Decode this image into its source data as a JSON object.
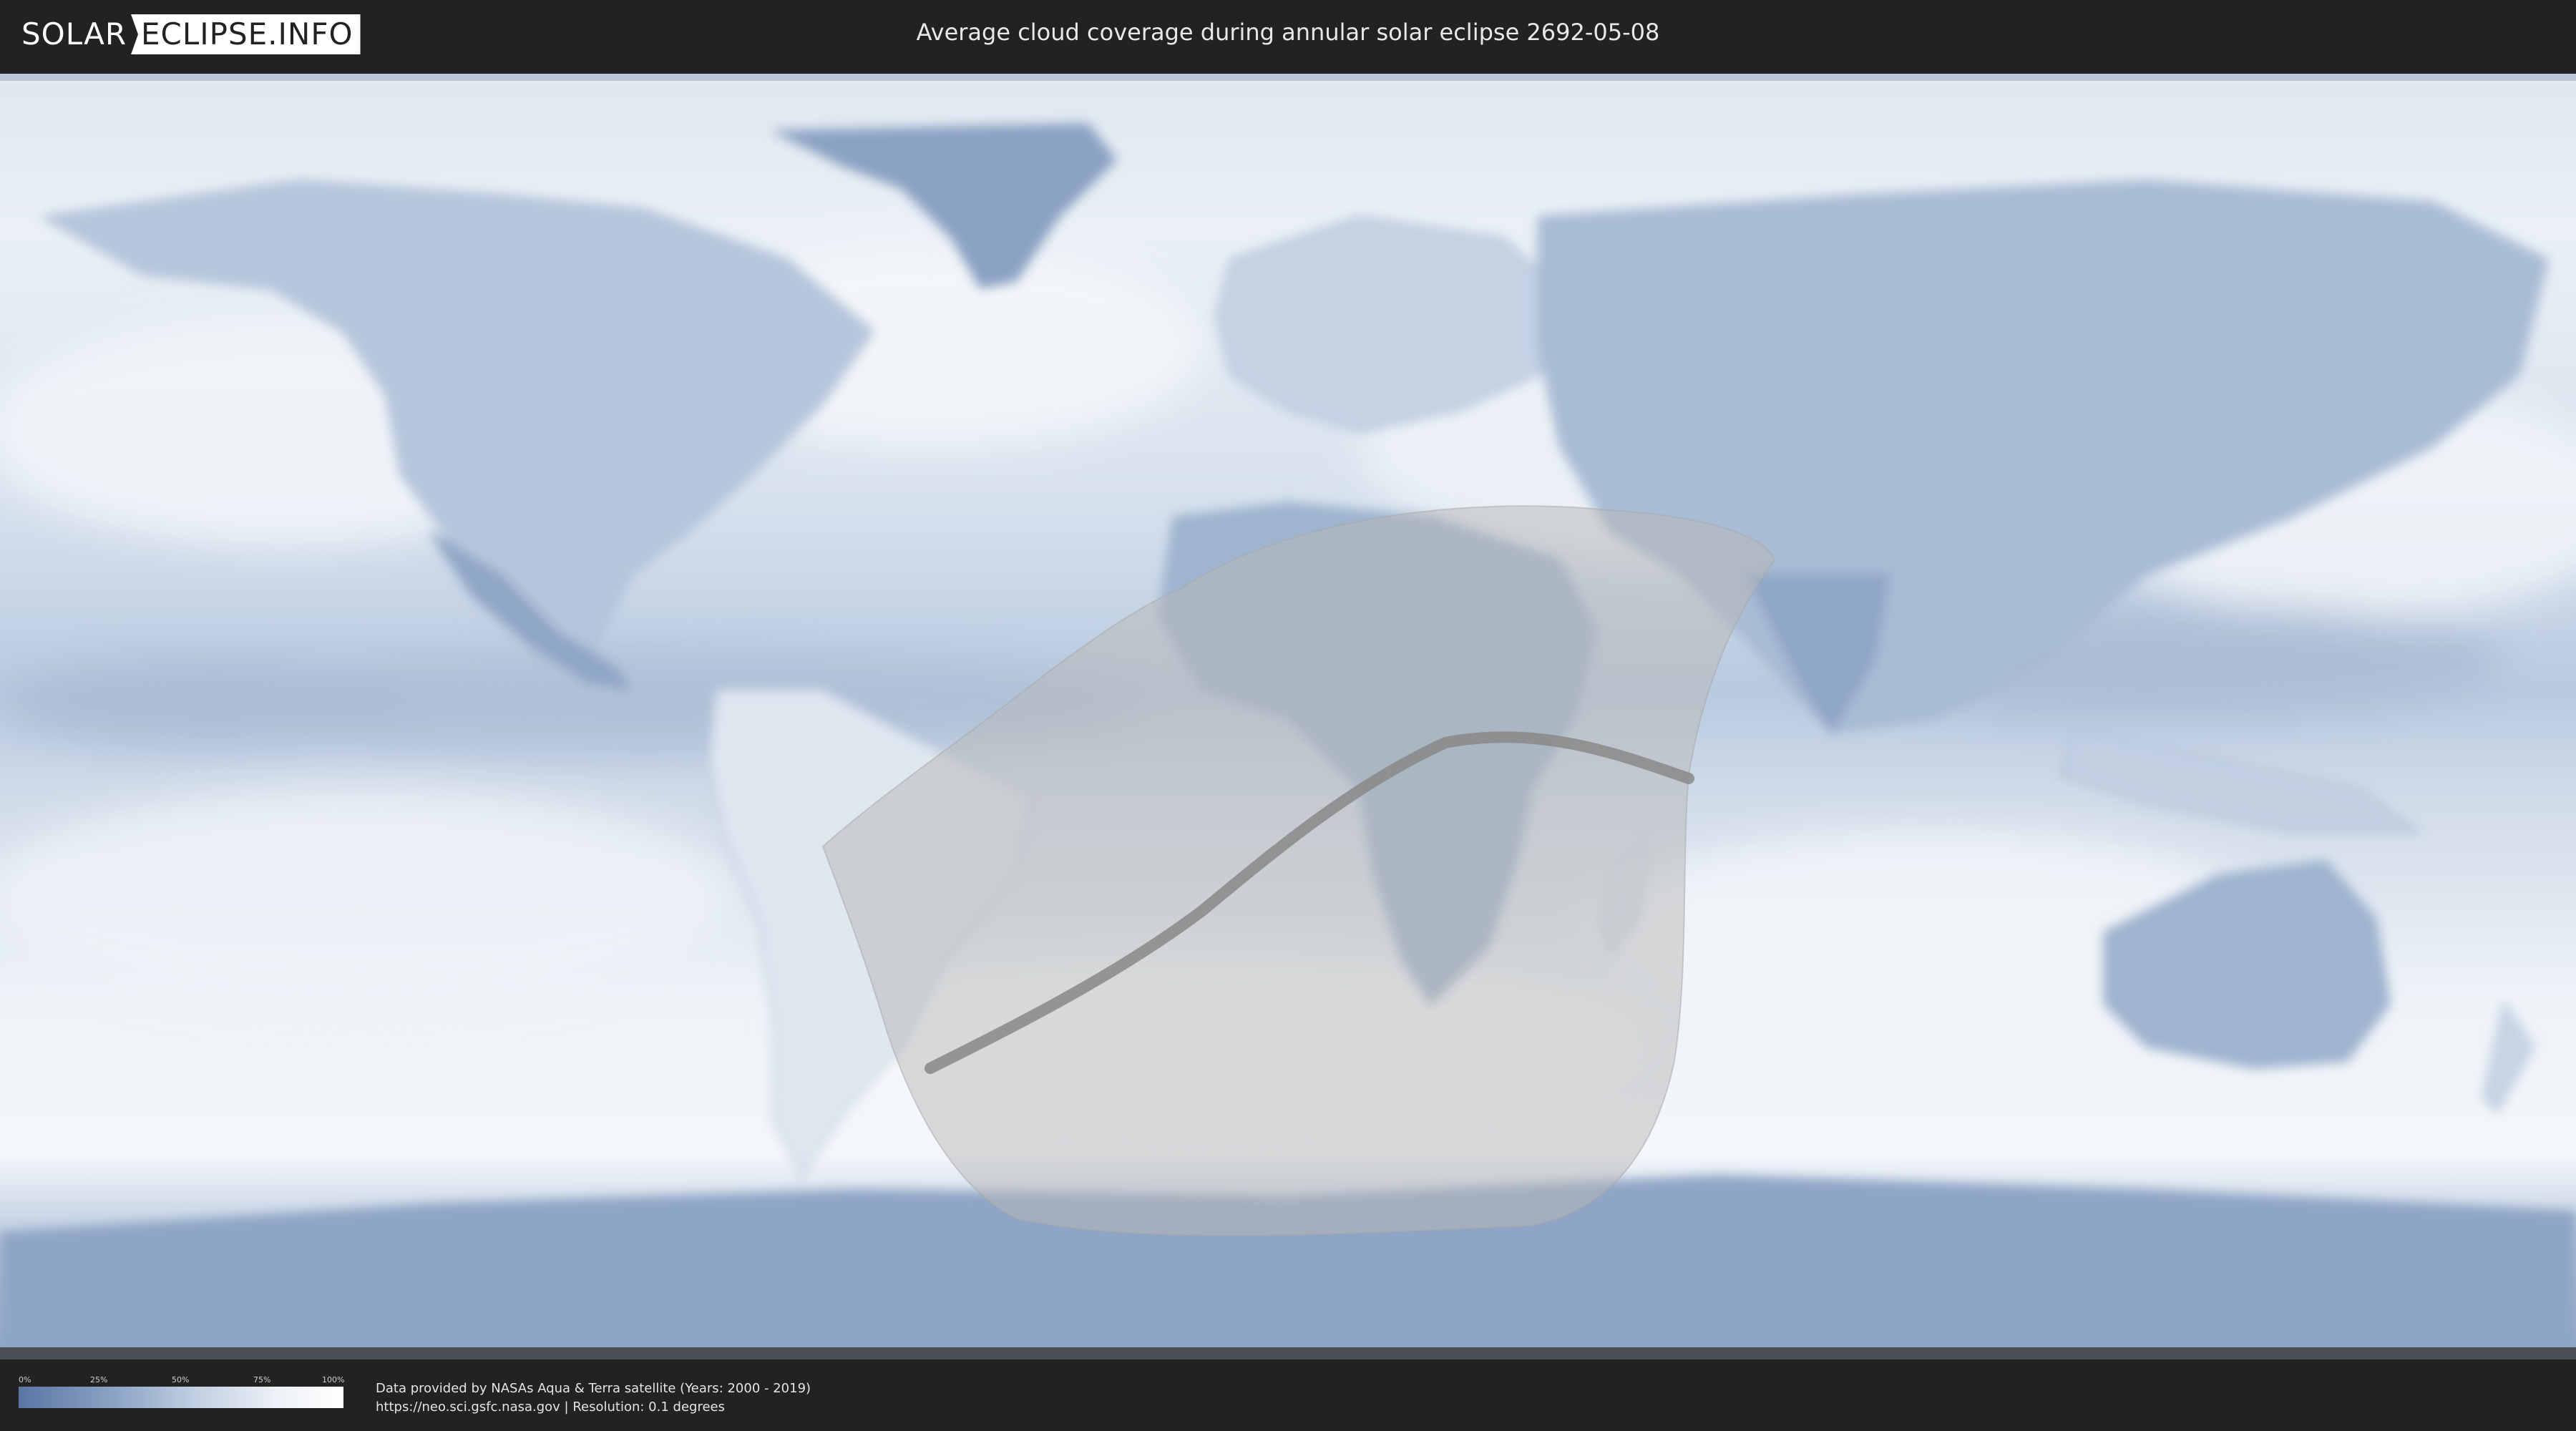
{
  "header": {
    "logo_left": "SOLAR",
    "logo_right": "ECLIPSE.INFO",
    "title": "Average cloud coverage during annular solar eclipse 2692-05-08"
  },
  "legend": {
    "ticks": [
      "0%",
      "25%",
      "50%",
      "75%",
      "100%"
    ],
    "colors": {
      "low": "#5a76a4",
      "high": "#ffffff"
    }
  },
  "footer": {
    "attribution_line1": "Data provided by NASAs Aqua & Terra satellite (Years: 2000 - 2019)",
    "attribution_line2": "https://neo.sci.gsfc.nasa.gov | Resolution: 0.1 degrees"
  },
  "map": {
    "layer": "cloud-coverage",
    "eclipse_zone_color": "#b8b8b8",
    "path_color": "#888888"
  }
}
